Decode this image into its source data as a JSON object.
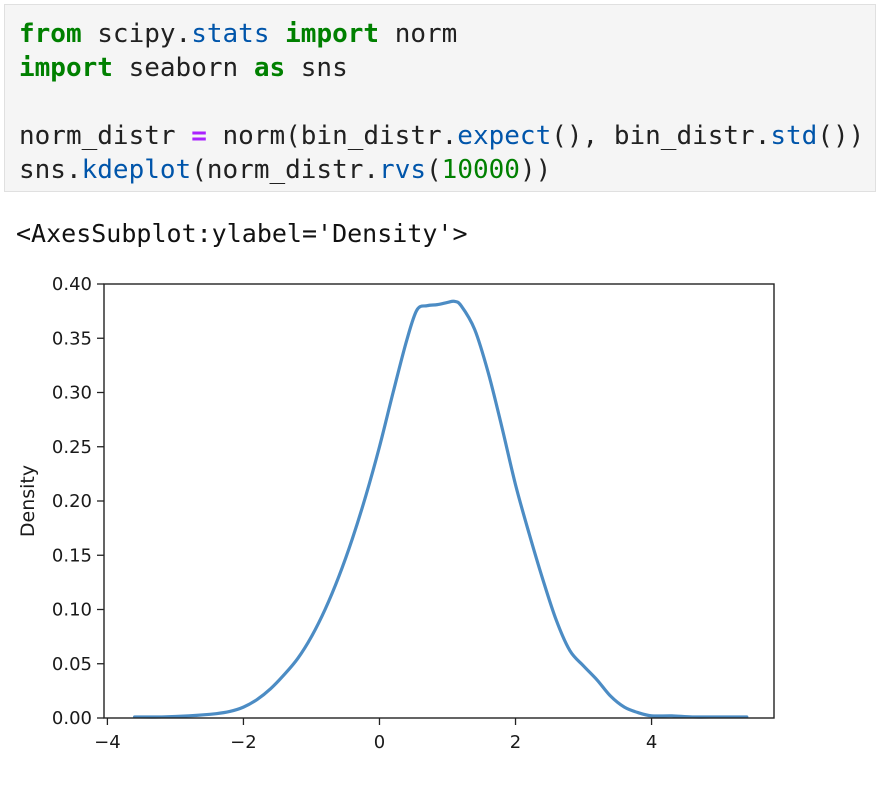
{
  "code_cell": {
    "lines": [
      [
        {
          "t": "from",
          "c": "kw"
        },
        {
          "t": " scipy.",
          "c": "plain"
        },
        {
          "t": "stats",
          "c": "fn"
        },
        {
          "t": " ",
          "c": "plain"
        },
        {
          "t": "import",
          "c": "kw"
        },
        {
          "t": " norm",
          "c": "plain"
        }
      ],
      [
        {
          "t": "import",
          "c": "kw"
        },
        {
          "t": " seaborn ",
          "c": "plain"
        },
        {
          "t": "as",
          "c": "kw"
        },
        {
          "t": " sns",
          "c": "plain"
        }
      ],
      [],
      [
        {
          "t": "norm_distr ",
          "c": "plain"
        },
        {
          "t": "=",
          "c": "op"
        },
        {
          "t": " norm(bin_distr.",
          "c": "plain"
        },
        {
          "t": "expect",
          "c": "fn"
        },
        {
          "t": "(), bin_distr.",
          "c": "plain"
        },
        {
          "t": "std",
          "c": "fn"
        },
        {
          "t": "())",
          "c": "plain"
        }
      ],
      [
        {
          "t": "sns.",
          "c": "plain"
        },
        {
          "t": "kdeplot",
          "c": "fn"
        },
        {
          "t": "(norm_distr.",
          "c": "plain"
        },
        {
          "t": "rvs",
          "c": "fn"
        },
        {
          "t": "(",
          "c": "plain"
        },
        {
          "t": "10000",
          "c": "num"
        },
        {
          "t": "))",
          "c": "plain"
        }
      ]
    ]
  },
  "output": {
    "repr_text": "<AxesSubplot:ylabel='Density'>"
  },
  "colors": {
    "line": "#4c8cc4",
    "axes": "#222222",
    "keyword": "#008000",
    "function": "#0055aa",
    "operator": "#aa22ff"
  },
  "chart_data": {
    "type": "line",
    "title": "",
    "xlabel": "",
    "ylabel": "Density",
    "xlim": [
      -4.05,
      5.8
    ],
    "ylim": [
      0,
      0.4
    ],
    "grid": false,
    "xticks": [
      -4,
      -2,
      0,
      2,
      4
    ],
    "xtick_labels": [
      "−4",
      "−2",
      "0",
      "2",
      "4"
    ],
    "yticks": [
      0,
      0.05,
      0.1,
      0.15,
      0.2,
      0.25,
      0.3,
      0.35,
      0.4
    ],
    "ytick_labels": [
      "0.00",
      "0.05",
      "0.10",
      "0.15",
      "0.20",
      "0.25",
      "0.30",
      "0.35",
      "0.40"
    ],
    "series": [
      {
        "x": [
          -3.6,
          -3.2,
          -2.8,
          -2.4,
          -2.2,
          -2.0,
          -1.8,
          -1.6,
          -1.4,
          -1.2,
          -1.0,
          -0.8,
          -0.6,
          -0.4,
          -0.2,
          0.0,
          0.2,
          0.4,
          0.55,
          0.7,
          0.85,
          1.0,
          1.1,
          1.2,
          1.4,
          1.6,
          1.8,
          2.0,
          2.2,
          2.4,
          2.6,
          2.8,
          3.0,
          3.2,
          3.4,
          3.6,
          3.8,
          4.0,
          4.3,
          4.6,
          5.0,
          5.4
        ],
        "y": [
          0.001,
          0.001,
          0.002,
          0.004,
          0.006,
          0.01,
          0.017,
          0.027,
          0.04,
          0.055,
          0.075,
          0.1,
          0.13,
          0.165,
          0.205,
          0.25,
          0.3,
          0.348,
          0.376,
          0.38,
          0.381,
          0.383,
          0.384,
          0.38,
          0.358,
          0.318,
          0.268,
          0.215,
          0.17,
          0.128,
          0.09,
          0.062,
          0.048,
          0.035,
          0.02,
          0.01,
          0.005,
          0.002,
          0.002,
          0.001,
          0.001,
          0.001
        ]
      }
    ]
  }
}
